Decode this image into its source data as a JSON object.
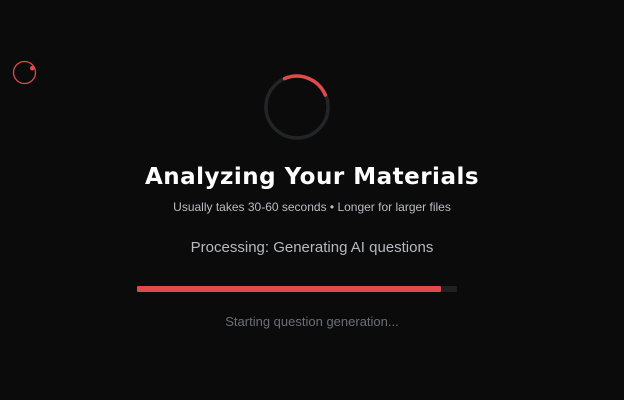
{
  "colors": {
    "background": "#0b0b0c",
    "accent": "#e24a4a",
    "track": "#202124",
    "spinner_track": "#232427"
  },
  "header": {
    "logo_icon": "spinner-logo-icon"
  },
  "loader": {
    "spinner_icon": "loading-spinner-icon"
  },
  "main": {
    "title": "Analyzing Your Materials",
    "subtitle": "Usually takes 30-60 seconds • Longer for larger files",
    "status": "Processing: Generating AI questions",
    "progress_fraction": 0.95,
    "progress_caption": "Starting question generation..."
  }
}
